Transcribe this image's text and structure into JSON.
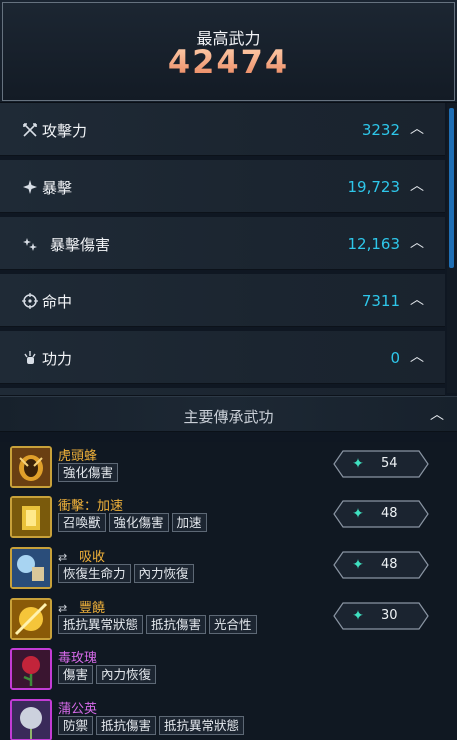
{
  "header": {
    "title": "最高武力",
    "value": "42474"
  },
  "stats": [
    {
      "icon": "crossed-swords-icon",
      "label": "攻擊力",
      "value": "3232"
    },
    {
      "icon": "burst-icon",
      "label": "暴擊",
      "value": "19,723"
    },
    {
      "icon": "spark-cluster-icon",
      "label": "暴擊傷害",
      "value": "12,163"
    },
    {
      "icon": "crosshair-icon",
      "label": "命中",
      "value": "7311"
    },
    {
      "icon": "fist-aura-icon",
      "label": "功力",
      "value": "0"
    }
  ],
  "skills_header": {
    "title": "主要傳承武功"
  },
  "skills": [
    {
      "name": "虎頭蜂",
      "rarity": "gold",
      "has_swap": false,
      "tags": [
        "強化傷害"
      ],
      "level": "54"
    },
    {
      "name": "衝擊：加速",
      "rarity": "gold",
      "has_swap": false,
      "tags": [
        "召喚獸",
        "強化傷害",
        "加速"
      ],
      "level": "48"
    },
    {
      "name": "吸收",
      "rarity": "gold",
      "has_swap": true,
      "tags": [
        "恢復生命力",
        "內力恢復"
      ],
      "level": "48"
    },
    {
      "name": "豐饒",
      "rarity": "gold",
      "has_swap": true,
      "tags": [
        "抵抗異常狀態",
        "抵抗傷害",
        "光合性"
      ],
      "level": "30"
    },
    {
      "name": "毒玫瑰",
      "rarity": "purple",
      "has_swap": false,
      "tags": [
        "傷害",
        "內力恢復"
      ],
      "level": null
    },
    {
      "name": "蒲公英",
      "rarity": "purple",
      "has_swap": false,
      "tags": [
        "防禦",
        "抵抗傷害",
        "抵抗異常狀態"
      ],
      "level": null
    }
  ],
  "colors": {
    "stat_value": "#2ec7ea",
    "gold_name": "#f0b13a",
    "purple_name": "#d56ae8",
    "power_value": "#f3a276"
  }
}
